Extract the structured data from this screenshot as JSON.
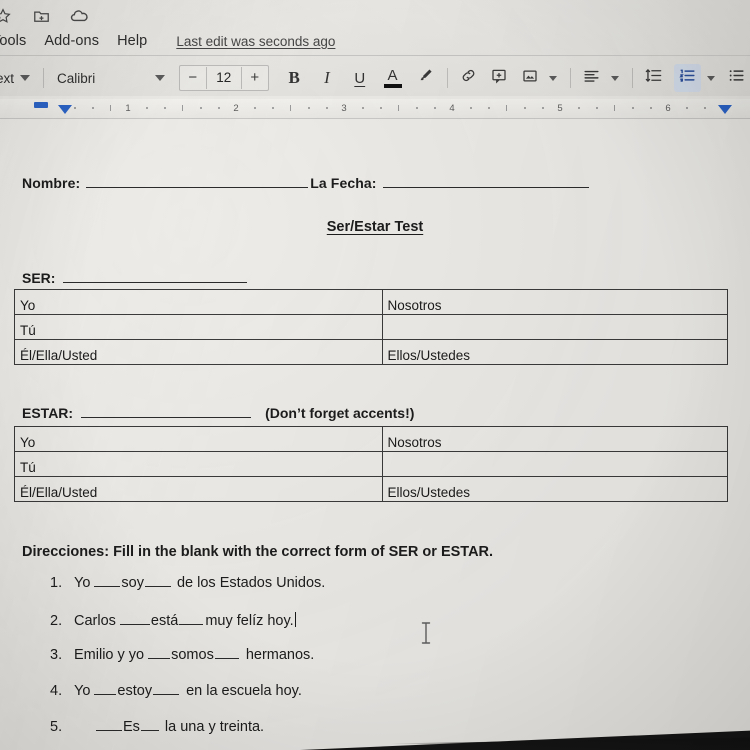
{
  "app": {
    "top_icons": [
      {
        "name": "star-icon",
        "glyph": "star"
      },
      {
        "name": "move-to-folder-icon",
        "glyph": "folder-add"
      },
      {
        "name": "cloud-saved-icon",
        "glyph": "cloud"
      }
    ],
    "menus": [
      "Tools",
      "Add-ons",
      "Help"
    ],
    "last_edit": "Last edit was seconds ago"
  },
  "toolbar": {
    "style_label": "ext",
    "font_name": "Calibri",
    "font_size_decrease": "−",
    "font_size": "12",
    "font_size_increase": "+",
    "bold": "B",
    "italic": "I",
    "underline": "U",
    "text_color": "A",
    "highlight": "highlight-pen-icon",
    "insert_link": "link-icon",
    "add_comment": "comment-icon",
    "insert_image": "image-icon",
    "align": "align-left-icon",
    "line_spacing": "line-spacing-icon",
    "numbered_list": "numbered-list-icon",
    "bulleted_list": "bulleted-list-icon",
    "accent_color": "#2b63c7",
    "active_button_bg": "#d6dfee"
  },
  "ruler": {
    "marks": [
      "1",
      "2",
      "3",
      "4",
      "5",
      "6"
    ],
    "indent_color": "#2b63c7"
  },
  "document": {
    "header": {
      "nombre_label": "Nombre:",
      "fecha_label": "La Fecha:"
    },
    "title": "Ser/Estar Test",
    "sections": [
      {
        "label": "SER:",
        "note": "",
        "table": {
          "rows": [
            {
              "left": "Yo",
              "right": "Nosotros"
            },
            {
              "left": "Tú",
              "right": ""
            },
            {
              "left": "Él/Ella/Usted",
              "right": "Ellos/Ustedes"
            }
          ]
        }
      },
      {
        "label": "ESTAR:",
        "note": "(Don’t forget accents!)",
        "table": {
          "rows": [
            {
              "left": "Yo",
              "right": "Nosotros"
            },
            {
              "left": "Tú",
              "right": ""
            },
            {
              "left": "Él/Ella/Usted",
              "right": "Ellos/Ustedes"
            }
          ]
        }
      }
    ],
    "directions": "Direcciones: Fill in the blank with the correct form of SER or ESTAR.",
    "questions": [
      {
        "num": "1.",
        "before": "Yo",
        "answer": "soy",
        "after": "de los Estados Unidos.",
        "cursor": false
      },
      {
        "num": "2.",
        "before": "Carlos",
        "answer": "está",
        "after": "muy felíz hoy.",
        "cursor": true
      },
      {
        "num": "3.",
        "before": "Emilio y yo",
        "answer": "somos",
        "after": "hermanos.",
        "cursor": false
      },
      {
        "num": "4.",
        "before": "Yo",
        "answer": "estoy",
        "after": "en la escuela hoy.",
        "cursor": false
      },
      {
        "num": "5.",
        "before": "",
        "answer": "Es",
        "after": "la una y treinta.",
        "cursor": false
      }
    ]
  }
}
